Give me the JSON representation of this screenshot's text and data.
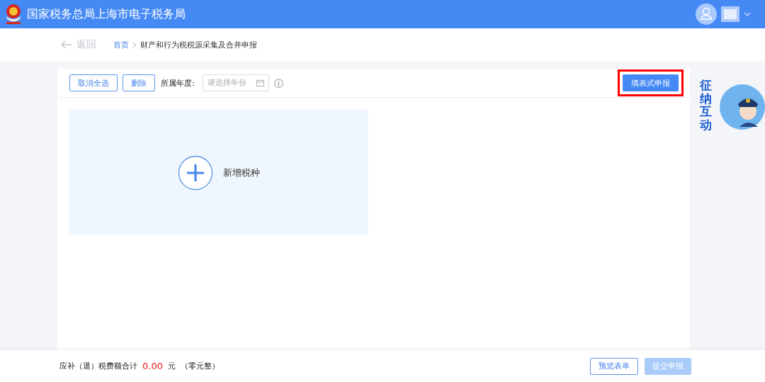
{
  "header": {
    "title": "国家税务总局上海市电子税务局"
  },
  "breadcrumb": {
    "back": "返回",
    "items": [
      {
        "label": "首页",
        "link": true
      },
      {
        "label": "财产和行为税税源采集及合并申报",
        "link": false
      }
    ]
  },
  "toolbar": {
    "buttons": [
      "取消全选",
      "删除"
    ],
    "year_label": "所属年度:",
    "year_placeholder": "请选择年份",
    "primary": {
      "label": "填表式申报",
      "highlighted": true
    }
  },
  "add_card": {
    "label": "新增税种"
  },
  "assistant": {
    "label": "征纳互动"
  },
  "footer": {
    "total_label": "应补（退）税费额合计",
    "amount": "0.00",
    "unit": "元",
    "amount_words": "（零元整）",
    "buttons": [
      {
        "label": "预览表单",
        "disabled": false
      },
      {
        "label": "提交申报",
        "disabled": true
      }
    ]
  }
}
